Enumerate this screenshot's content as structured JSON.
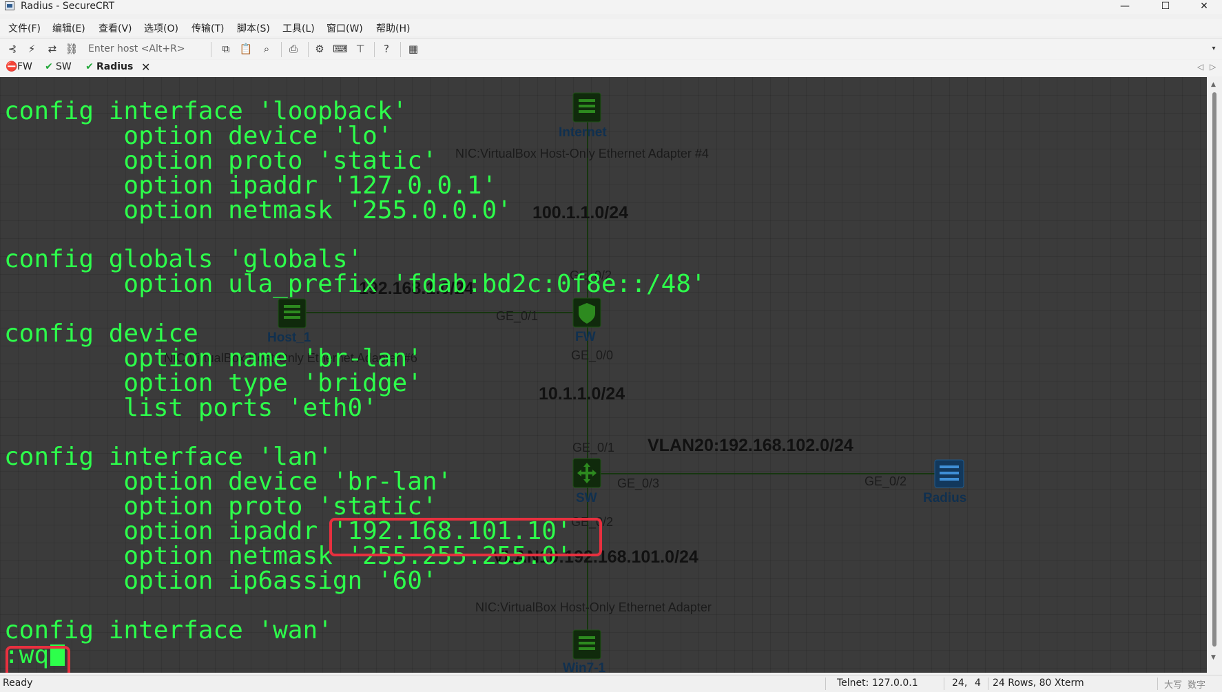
{
  "window": {
    "title": "Radius - SecureCRT",
    "minimize": "—",
    "maximize": "☐",
    "close": "✕"
  },
  "menu": [
    "文件(F)",
    "编辑(E)",
    "查看(V)",
    "选项(O)",
    "传输(T)",
    "脚本(S)",
    "工具(L)",
    "窗口(W)",
    "帮助(H)"
  ],
  "toolbar": {
    "host_placeholder": "Enter host <Alt+R>"
  },
  "tabs": [
    {
      "label": "FW",
      "status": "error",
      "status_glyph": "⛔",
      "color": "#e0242c",
      "active": false
    },
    {
      "label": "SW",
      "status": "connected",
      "status_glyph": "✔",
      "color": "#22a83a",
      "active": false
    },
    {
      "label": "Radius",
      "status": "connected",
      "status_glyph": "✔",
      "color": "#22a83a",
      "active": true
    }
  ],
  "terminal": {
    "lines": [
      "config interface 'loopback'",
      "        option device 'lo'",
      "        option proto 'static'",
      "        option ipaddr '127.0.0.1'",
      "        option netmask '255.0.0.0'",
      "",
      "config globals 'globals'",
      "        option ula_prefix 'fdab:bd2c:0f8e::/48'",
      "",
      "config device",
      "        option name 'br-lan'",
      "        option type 'bridge'",
      "        list ports 'eth0'",
      "",
      "config interface 'lan'",
      "        option device 'br-lan'",
      "        option proto 'static'",
      "        option ipaddr '192.168.101.10'",
      "        option netmask '255.255.255.0'",
      "        option ip6assign '60'",
      "",
      "config interface 'wan'"
    ],
    "command": ":wq",
    "text_color": "#2dff4b",
    "highlight_color": "#e8303f"
  },
  "topology": {
    "devices": {
      "internet": "Internet",
      "host1": "Host_1",
      "fw": "FW",
      "sw": "SW",
      "radius": "Radius",
      "win7": "Win7-1"
    },
    "networks": {
      "wan": "100.1.1.0/24",
      "host_net": "192.168.1.0/24",
      "fw_sw": "10.1.1.0/24",
      "vlan20": "VLAN20:192.168.102.0/24",
      "vlan10": "VLAN10:192.168.101.0/24"
    },
    "nics": {
      "internet": "NIC:VirtualBox Host-Only Ethernet Adapter #4",
      "host1": "NIC:VirtualBox Host-Only Ethernet Adapter #6",
      "win7": "NIC:VirtualBox Host-Only Ethernet Adapter"
    },
    "ports": {
      "fw_ge02": "GE_0/2",
      "fw_ge01": "GE_0/1",
      "fw_ge00": "GE_0/0",
      "sw_ge01": "GE_0/1",
      "sw_ge03": "GE_0/3",
      "radius_ge02": "GE_0/2",
      "sw_ge02": "GE_0/2"
    }
  },
  "statusbar": {
    "ready": "Ready",
    "connection": "Telnet: 127.0.0.1",
    "cursor_row": "24,",
    "cursor_col": "4",
    "size": "24 Rows, 80 Xterm",
    "caps": "大写",
    "num": "数字"
  }
}
